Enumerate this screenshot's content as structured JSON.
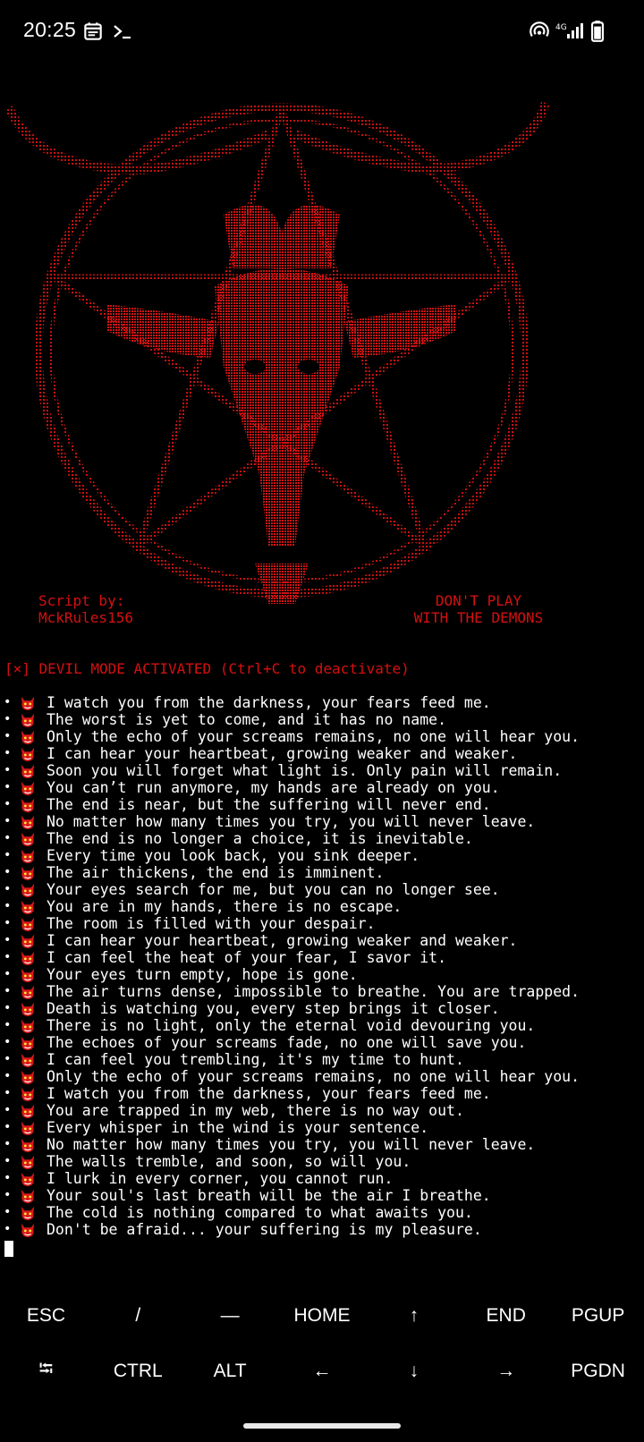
{
  "status_bar": {
    "time": "20:25",
    "icons_left": [
      "calendar-icon",
      "terminal-prompt-icon"
    ],
    "icons_right": [
      "hotspot-icon",
      "signal-4g-icon",
      "battery-icon"
    ],
    "network_label": "4G"
  },
  "art": {
    "credit_left": "Script by:\nMckRules156",
    "credit_right": "DON'T PLAY\nWITH THE DEMONS",
    "color": "#d51010"
  },
  "terminal": {
    "mode_line": "[×] DEVIL MODE ACTIVATED (Ctrl+C to deactivate)",
    "bullet": "•",
    "messages": [
      "I watch you from the darkness, your fears feed me.",
      "The worst is yet to come, and it has no name.",
      "Only the echo of your screams remains, no one will hear you.",
      "I can hear your heartbeat, growing weaker and weaker.",
      "Soon you will forget what light is. Only pain will remain.",
      "You can’t run anymore, my hands are already on you.",
      "The end is near, but the suffering will never end.",
      "No matter how many times you try, you will never leave.",
      "The end is no longer a choice, it is inevitable.",
      "Every time you look back, you sink deeper.",
      "The air thickens, the end is imminent.",
      "Your eyes search for me, but you can no longer see.",
      "You are in my hands, there is no escape.",
      "The room is filled with your despair.",
      "I can hear your heartbeat, growing weaker and weaker.",
      "I can feel the heat of your fear, I savor it.",
      "Your eyes turn empty, hope is gone.",
      "The air turns dense, impossible to breathe. You are trapped.",
      "Death is watching you, every step brings it closer.",
      "There is no light, only the eternal void devouring you.",
      "The echoes of your screams fade, no one will save you.",
      "I can feel you trembling, it's my time to hunt.",
      "Only the echo of your screams remains, no one will hear you.",
      "I watch you from the darkness, your fears feed me.",
      "You are trapped in my web, there is no way out.",
      "Every whisper in the wind is your sentence.",
      "No matter how many times you try, you will never leave.",
      "The walls tremble, and soon, so will you.",
      "I lurk in every corner, you cannot run.",
      "Your soul's last breath will be the air I breathe.",
      "The cold is nothing compared to what awaits you.",
      "Don't be afraid... your suffering is my pleasure."
    ]
  },
  "extra_keys": {
    "row1": [
      {
        "name": "key-esc",
        "label": "ESC"
      },
      {
        "name": "key-slash",
        "label": "/"
      },
      {
        "name": "key-dash",
        "label": "—"
      },
      {
        "name": "key-home",
        "label": "HOME"
      },
      {
        "name": "key-up",
        "label": "↑"
      },
      {
        "name": "key-end",
        "label": "END"
      },
      {
        "name": "key-pgup",
        "label": "PGUP"
      }
    ],
    "row2": [
      {
        "name": "key-tab",
        "label": "⭾"
      },
      {
        "name": "key-ctrl",
        "label": "CTRL"
      },
      {
        "name": "key-alt",
        "label": "ALT"
      },
      {
        "name": "key-left",
        "label": "←"
      },
      {
        "name": "key-down",
        "label": "↓"
      },
      {
        "name": "key-right",
        "label": "→"
      },
      {
        "name": "key-pgdn",
        "label": "PGDN"
      }
    ]
  }
}
